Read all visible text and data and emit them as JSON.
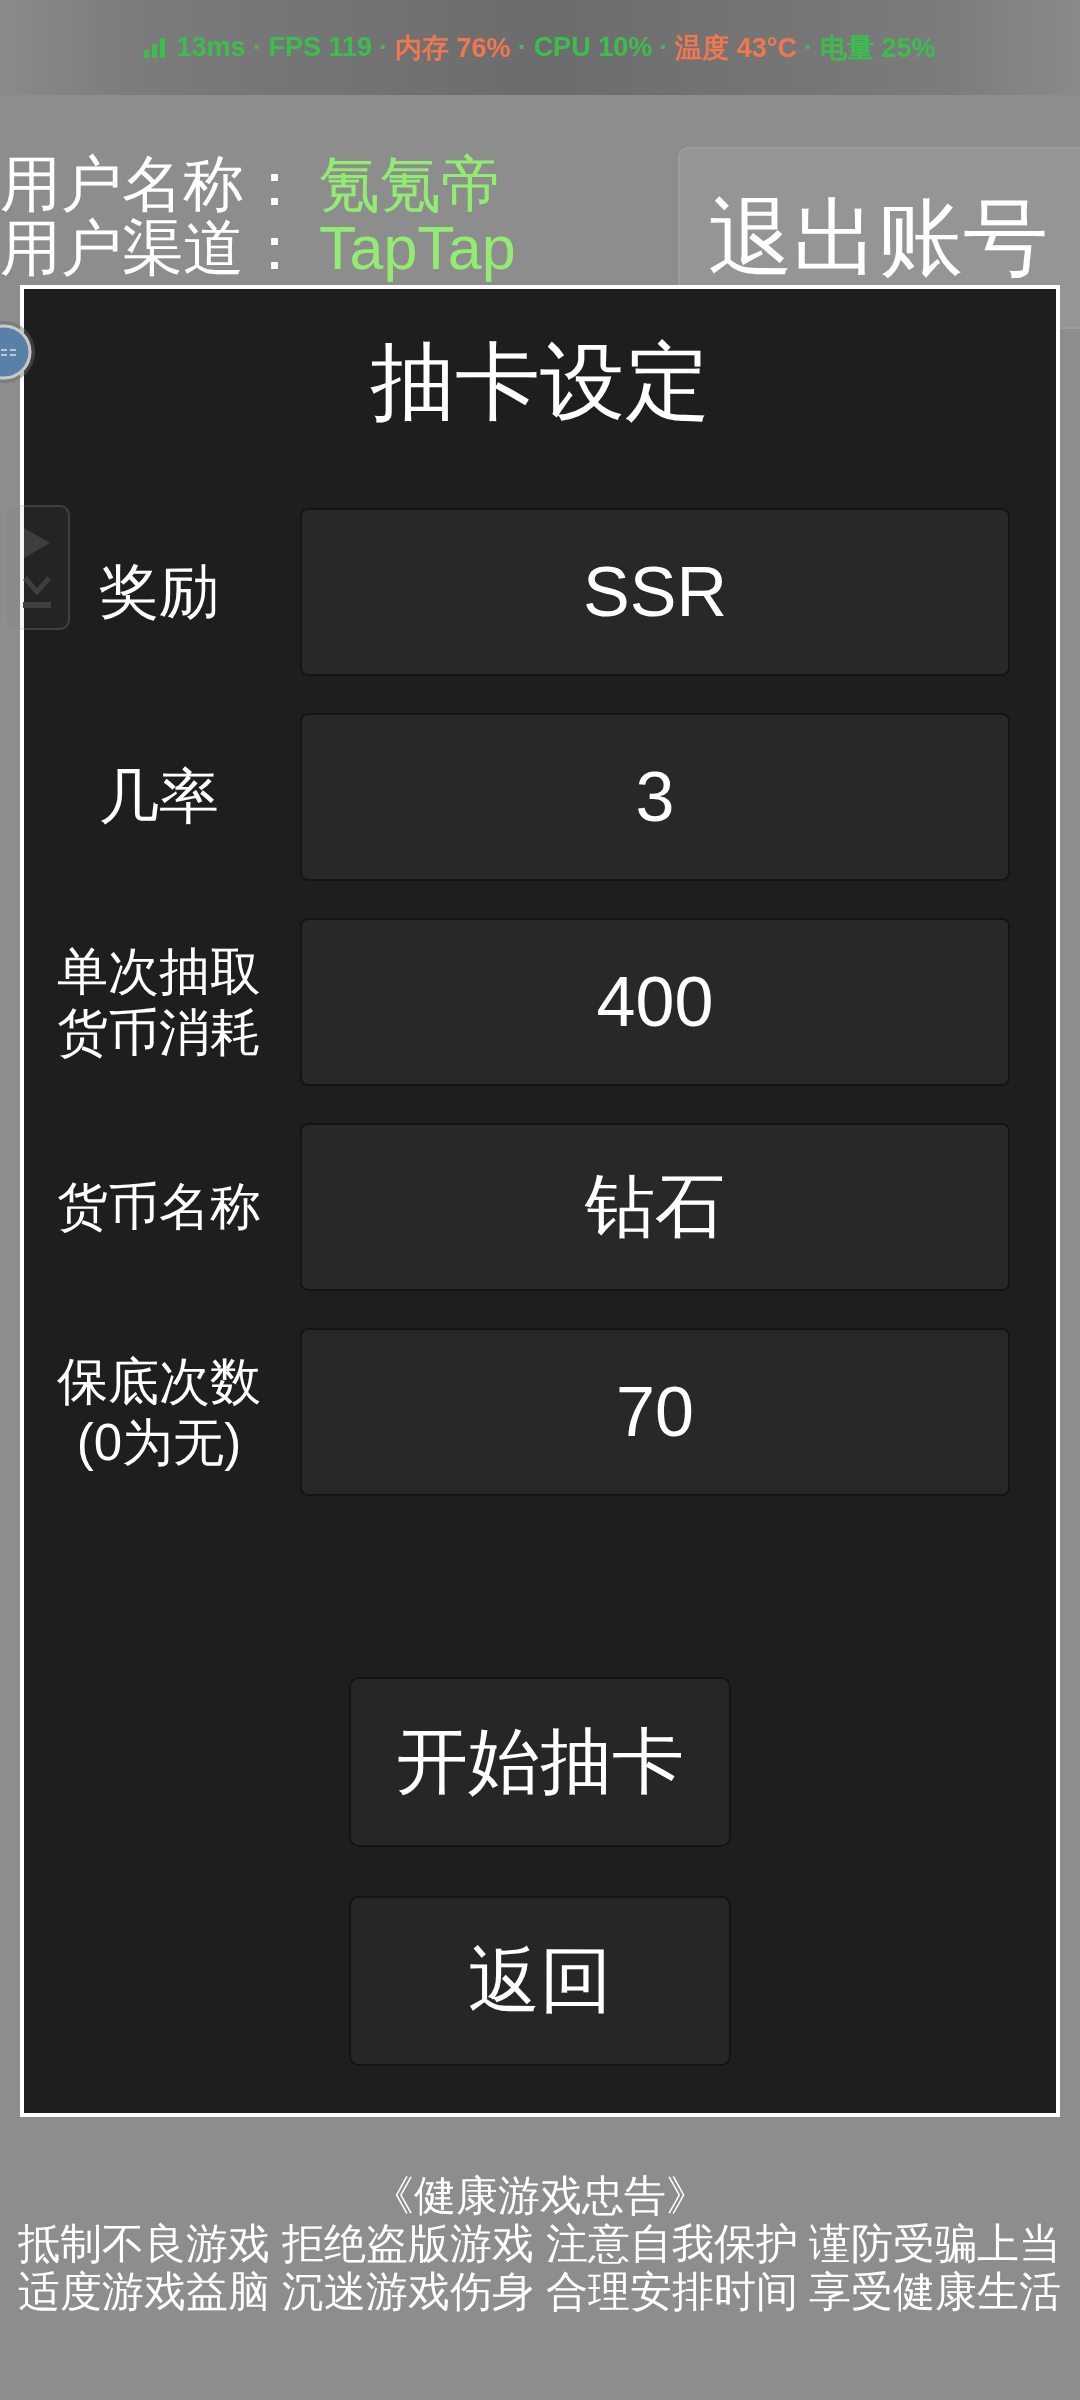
{
  "stats_bar": {
    "separator": "·",
    "items": [
      {
        "text": "13ms",
        "color": "#3cbe4e"
      },
      {
        "text": "FPS 119",
        "color": "#3cbe4e"
      },
      {
        "text": "内存 76%",
        "color": "#f07850"
      },
      {
        "text": "CPU 10%",
        "color": "#3cbe4e"
      },
      {
        "text": "温度 43°C",
        "color": "#f07850"
      },
      {
        "text": "电量 25%",
        "color": "#3cbe4e"
      }
    ]
  },
  "account": {
    "fields": [
      {
        "label": "用户名称：",
        "value": "氪氪帝"
      },
      {
        "label": "用户渠道：",
        "value": "TapTap"
      }
    ],
    "logout_button": "退出账号"
  },
  "dialog": {
    "title": "抽卡设定",
    "fields": [
      {
        "label_lines": [
          "奖励"
        ],
        "value": "SSR"
      },
      {
        "label_lines": [
          "几率"
        ],
        "value": "3"
      },
      {
        "label_lines": [
          "单次抽取",
          "货币消耗"
        ],
        "value": "400"
      },
      {
        "label_lines": [
          "货币名称"
        ],
        "value": "钻石"
      },
      {
        "label_lines": [
          "保底次数",
          "(0为无)"
        ],
        "value": "70"
      }
    ],
    "buttons": [
      "开始抽卡",
      "返回"
    ]
  },
  "health_notice": {
    "title": "《健康游戏忠告》",
    "lines": [
      "抵制不良游戏 拒绝盗版游戏 注意自我保护 谨防受骗上当",
      "适度游戏益脑 沉迷游戏伤身 合理安排时间 享受健康生活"
    ]
  }
}
